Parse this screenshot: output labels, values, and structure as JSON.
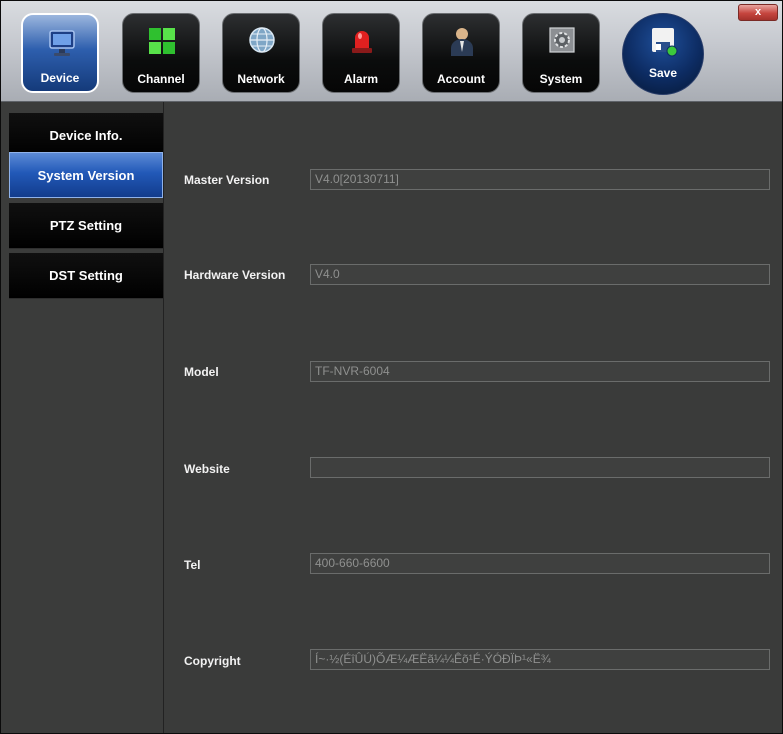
{
  "toolbar": {
    "buttons": [
      {
        "label": "Device",
        "icon": "monitor-icon",
        "active": true
      },
      {
        "label": "Channel",
        "icon": "grid-icon",
        "active": false
      },
      {
        "label": "Network",
        "icon": "globe-icon",
        "active": false
      },
      {
        "label": "Alarm",
        "icon": "siren-icon",
        "active": false
      },
      {
        "label": "Account",
        "icon": "user-icon",
        "active": false
      },
      {
        "label": "System",
        "icon": "gear-icon",
        "active": false
      }
    ],
    "save_label": "Save",
    "close_label": "x"
  },
  "sidebar": {
    "items": [
      {
        "label": "Device Info.",
        "active": false
      },
      {
        "label": "System Version",
        "active": true
      },
      {
        "label": "PTZ Setting",
        "active": false
      },
      {
        "label": "DST Setting",
        "active": false
      }
    ]
  },
  "fields": [
    {
      "label": "Master Version",
      "value": "V4.0[20130711]"
    },
    {
      "label": "Hardware Version",
      "value": "V4.0"
    },
    {
      "label": "Model",
      "value": "TF-NVR-6004"
    },
    {
      "label": "Website",
      "value": ""
    },
    {
      "label": "Tel",
      "value": "400-660-6600"
    },
    {
      "label": "Copyright",
      "value": "Í~·½(ÉîÛÚ)ÕÆ¼ÆËã¼¼Êõ¹É·ÝÓÐÏÞ¹«Ë¾"
    }
  ],
  "colors": {
    "accent_active": "#2259b8",
    "background": "#3a3b3a",
    "sidebar_item": "#000000",
    "close_button": "#c6463f"
  }
}
